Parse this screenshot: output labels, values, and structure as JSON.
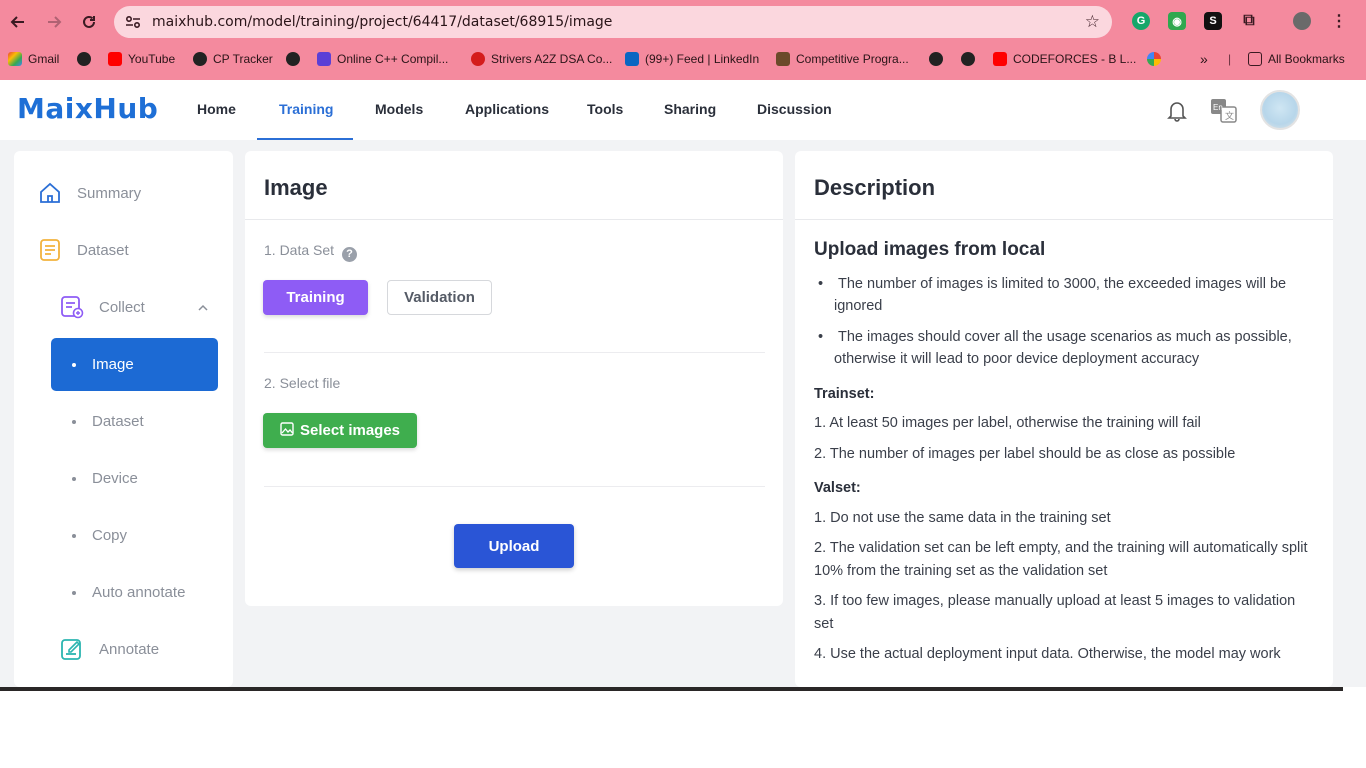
{
  "browser": {
    "url": "maixhub.com/model/training/project/64417/dataset/68915/image",
    "bookmarks": [
      {
        "label": "Gmail",
        "color": "#ea4335"
      },
      {
        "label": "",
        "color": "#222222"
      },
      {
        "label": "YouTube",
        "color": "#ff0000"
      },
      {
        "label": "CP Tracker",
        "color": "#222222"
      },
      {
        "label": "",
        "color": "#222222"
      },
      {
        "label": "Online C++ Compil...",
        "color": "#5b3fd6"
      },
      {
        "label": "Strivers A2Z DSA Co...",
        "color": "#d41c1c"
      },
      {
        "label": "(99+) Feed | LinkedIn",
        "color": "#0a66c2"
      },
      {
        "label": "Competitive Progra...",
        "color": "#6b4a2a"
      },
      {
        "label": "",
        "color": "#222222"
      },
      {
        "label": "",
        "color": "#222222"
      },
      {
        "label": "CODEFORCES - B L...",
        "color": "#ff0000"
      },
      {
        "label": "",
        "color": "#4285f4"
      }
    ],
    "overflow": "»",
    "all_bookmarks": "All Bookmarks"
  },
  "header": {
    "logo": "MaixHub",
    "nav": [
      "Home",
      "Training",
      "Models",
      "Applications",
      "Tools",
      "Sharing",
      "Discussion"
    ],
    "active_nav": "Training",
    "lang_badge": "En"
  },
  "sidebar": {
    "summary": "Summary",
    "dataset": "Dataset",
    "collect": "Collect",
    "sub_items": [
      "Image",
      "Dataset",
      "Device",
      "Copy",
      "Auto annotate"
    ],
    "active_sub": "Image",
    "annotate": "Annotate"
  },
  "main": {
    "title": "Image",
    "step1": "1. Data Set",
    "help": "?",
    "training_btn": "Training",
    "validation_btn": "Validation",
    "step2": "2. Select file",
    "select_btn": "Select images",
    "upload_btn": "Upload"
  },
  "description": {
    "title": "Description",
    "heading": "Upload images from local",
    "bullets": [
      "The number of images is limited to 3000, the exceeded images will be ignored",
      "The images should cover all the usage scenarios as much as possible, otherwise it will lead to poor device deployment accuracy"
    ],
    "trainset_label": "Trainset:",
    "trainset": [
      "1. At least 50 images per label, otherwise the training will fail",
      "2. The number of images per label should be as close as possible"
    ],
    "valset_label": "Valset:",
    "valset": [
      "1. Do not use the same data in the training set",
      "2. The validation set can be left empty, and the training will automatically split 10% from the training set as the validation set",
      "3. If too few images, please manually upload at least 5 images to validation set",
      "4. Use the actual deployment input data. Otherwise, the model may work"
    ]
  },
  "colors": {
    "accent": "#2b6fd6",
    "training_btn": "#8e5cf5",
    "select_btn": "#3fae4e",
    "upload_btn": "#2a55d6",
    "active_sidebar": "#1c6ad4",
    "chrome": "#f48a9e"
  }
}
